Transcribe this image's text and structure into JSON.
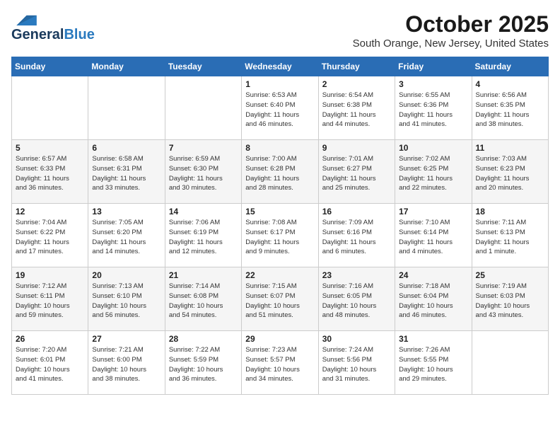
{
  "header": {
    "logo_general": "General",
    "logo_blue": "Blue",
    "month": "October 2025",
    "location": "South Orange, New Jersey, United States"
  },
  "weekdays": [
    "Sunday",
    "Monday",
    "Tuesday",
    "Wednesday",
    "Thursday",
    "Friday",
    "Saturday"
  ],
  "weeks": [
    [
      {
        "day": "",
        "info": ""
      },
      {
        "day": "",
        "info": ""
      },
      {
        "day": "",
        "info": ""
      },
      {
        "day": "1",
        "info": "Sunrise: 6:53 AM\nSunset: 6:40 PM\nDaylight: 11 hours\nand 46 minutes."
      },
      {
        "day": "2",
        "info": "Sunrise: 6:54 AM\nSunset: 6:38 PM\nDaylight: 11 hours\nand 44 minutes."
      },
      {
        "day": "3",
        "info": "Sunrise: 6:55 AM\nSunset: 6:36 PM\nDaylight: 11 hours\nand 41 minutes."
      },
      {
        "day": "4",
        "info": "Sunrise: 6:56 AM\nSunset: 6:35 PM\nDaylight: 11 hours\nand 38 minutes."
      }
    ],
    [
      {
        "day": "5",
        "info": "Sunrise: 6:57 AM\nSunset: 6:33 PM\nDaylight: 11 hours\nand 36 minutes."
      },
      {
        "day": "6",
        "info": "Sunrise: 6:58 AM\nSunset: 6:31 PM\nDaylight: 11 hours\nand 33 minutes."
      },
      {
        "day": "7",
        "info": "Sunrise: 6:59 AM\nSunset: 6:30 PM\nDaylight: 11 hours\nand 30 minutes."
      },
      {
        "day": "8",
        "info": "Sunrise: 7:00 AM\nSunset: 6:28 PM\nDaylight: 11 hours\nand 28 minutes."
      },
      {
        "day": "9",
        "info": "Sunrise: 7:01 AM\nSunset: 6:27 PM\nDaylight: 11 hours\nand 25 minutes."
      },
      {
        "day": "10",
        "info": "Sunrise: 7:02 AM\nSunset: 6:25 PM\nDaylight: 11 hours\nand 22 minutes."
      },
      {
        "day": "11",
        "info": "Sunrise: 7:03 AM\nSunset: 6:23 PM\nDaylight: 11 hours\nand 20 minutes."
      }
    ],
    [
      {
        "day": "12",
        "info": "Sunrise: 7:04 AM\nSunset: 6:22 PM\nDaylight: 11 hours\nand 17 minutes."
      },
      {
        "day": "13",
        "info": "Sunrise: 7:05 AM\nSunset: 6:20 PM\nDaylight: 11 hours\nand 14 minutes."
      },
      {
        "day": "14",
        "info": "Sunrise: 7:06 AM\nSunset: 6:19 PM\nDaylight: 11 hours\nand 12 minutes."
      },
      {
        "day": "15",
        "info": "Sunrise: 7:08 AM\nSunset: 6:17 PM\nDaylight: 11 hours\nand 9 minutes."
      },
      {
        "day": "16",
        "info": "Sunrise: 7:09 AM\nSunset: 6:16 PM\nDaylight: 11 hours\nand 6 minutes."
      },
      {
        "day": "17",
        "info": "Sunrise: 7:10 AM\nSunset: 6:14 PM\nDaylight: 11 hours\nand 4 minutes."
      },
      {
        "day": "18",
        "info": "Sunrise: 7:11 AM\nSunset: 6:13 PM\nDaylight: 11 hours\nand 1 minute."
      }
    ],
    [
      {
        "day": "19",
        "info": "Sunrise: 7:12 AM\nSunset: 6:11 PM\nDaylight: 10 hours\nand 59 minutes."
      },
      {
        "day": "20",
        "info": "Sunrise: 7:13 AM\nSunset: 6:10 PM\nDaylight: 10 hours\nand 56 minutes."
      },
      {
        "day": "21",
        "info": "Sunrise: 7:14 AM\nSunset: 6:08 PM\nDaylight: 10 hours\nand 54 minutes."
      },
      {
        "day": "22",
        "info": "Sunrise: 7:15 AM\nSunset: 6:07 PM\nDaylight: 10 hours\nand 51 minutes."
      },
      {
        "day": "23",
        "info": "Sunrise: 7:16 AM\nSunset: 6:05 PM\nDaylight: 10 hours\nand 48 minutes."
      },
      {
        "day": "24",
        "info": "Sunrise: 7:18 AM\nSunset: 6:04 PM\nDaylight: 10 hours\nand 46 minutes."
      },
      {
        "day": "25",
        "info": "Sunrise: 7:19 AM\nSunset: 6:03 PM\nDaylight: 10 hours\nand 43 minutes."
      }
    ],
    [
      {
        "day": "26",
        "info": "Sunrise: 7:20 AM\nSunset: 6:01 PM\nDaylight: 10 hours\nand 41 minutes."
      },
      {
        "day": "27",
        "info": "Sunrise: 7:21 AM\nSunset: 6:00 PM\nDaylight: 10 hours\nand 38 minutes."
      },
      {
        "day": "28",
        "info": "Sunrise: 7:22 AM\nSunset: 5:59 PM\nDaylight: 10 hours\nand 36 minutes."
      },
      {
        "day": "29",
        "info": "Sunrise: 7:23 AM\nSunset: 5:57 PM\nDaylight: 10 hours\nand 34 minutes."
      },
      {
        "day": "30",
        "info": "Sunrise: 7:24 AM\nSunset: 5:56 PM\nDaylight: 10 hours\nand 31 minutes."
      },
      {
        "day": "31",
        "info": "Sunrise: 7:26 AM\nSunset: 5:55 PM\nDaylight: 10 hours\nand 29 minutes."
      },
      {
        "day": "",
        "info": ""
      }
    ]
  ]
}
